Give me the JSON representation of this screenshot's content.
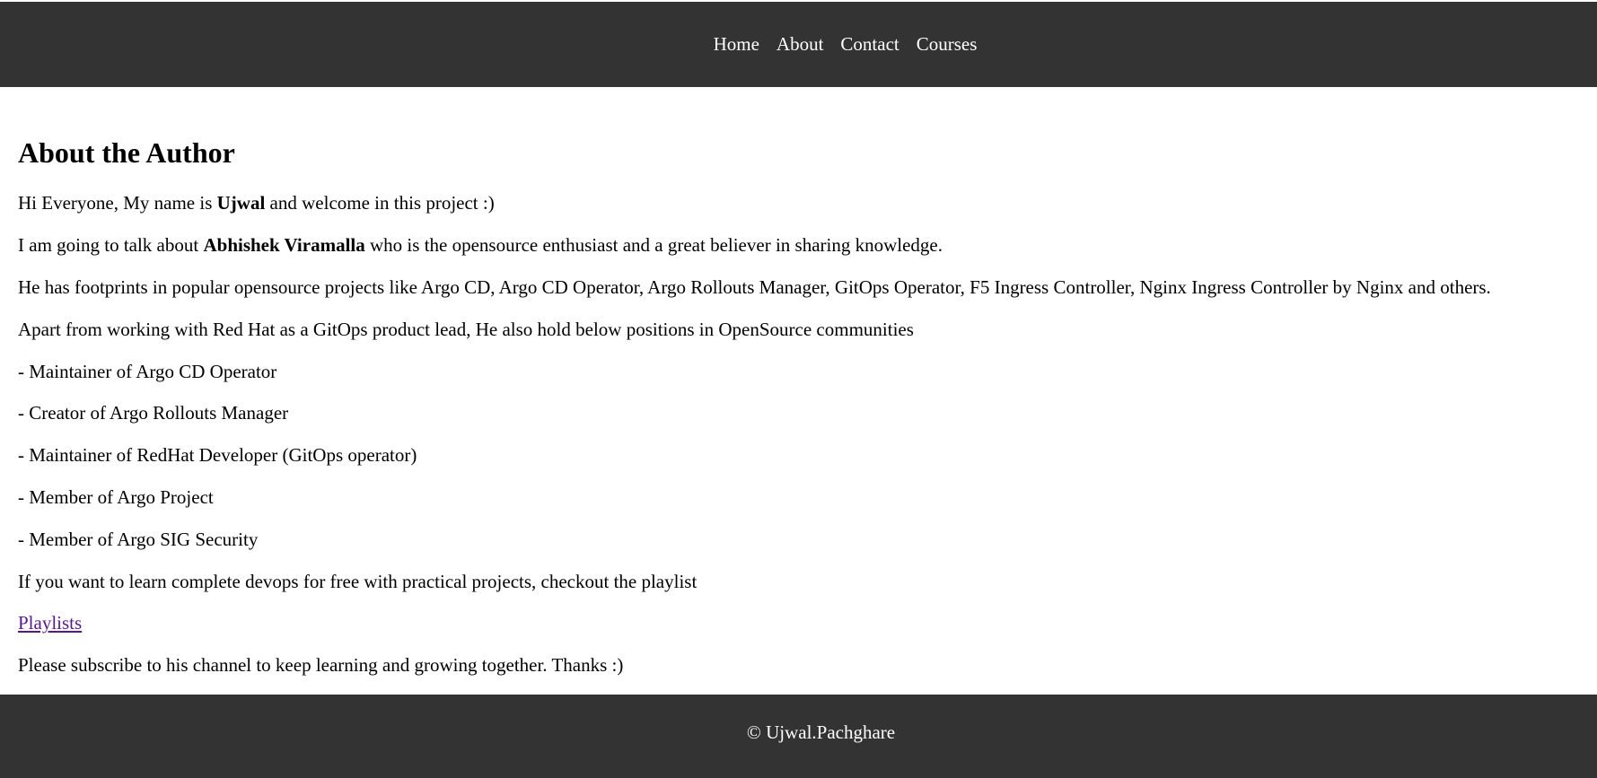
{
  "nav": {
    "items": [
      "Home",
      "About",
      "Contact",
      "Courses"
    ]
  },
  "main": {
    "title": "About the Author",
    "intro": {
      "pre": "Hi Everyone, My name is ",
      "name": "Ujwal",
      "post": " and welcome in this project :)"
    },
    "talk": {
      "pre": "I am going to talk about ",
      "name": "Abhishek Viramalla",
      "post": " who is the opensource enthusiast and a great believer in sharing knowledge."
    },
    "footprints": "He has footprints in popular opensource projects like Argo CD, Argo CD Operator, Argo Rollouts Manager, GitOps Operator, F5 Ingress Controller, Nginx Ingress Controller by Nginx and others.",
    "positions_intro": "Apart from working with Red Hat as a GitOps product lead, He also hold below positions in OpenSource communities",
    "positions": [
      "- Maintainer of Argo CD Operator",
      "- Creator of Argo Rollouts Manager",
      "- Maintainer of RedHat Developer (GitOps operator)",
      "- Member of Argo Project",
      "- Member of Argo SIG Security"
    ],
    "learn": "If you want to learn complete devops for free with practical projects, checkout the playlist",
    "playlist_link": "Playlists",
    "subscribe": "Please subscribe to his channel to keep learning and growing together. Thanks :)"
  },
  "footer": {
    "copyright": "© Ujwal.Pachghare"
  },
  "colors": {
    "header_bg": "#333333",
    "footer_bg": "#333333",
    "nav_text": "#ffffff",
    "link_visited": "#551a8b"
  }
}
